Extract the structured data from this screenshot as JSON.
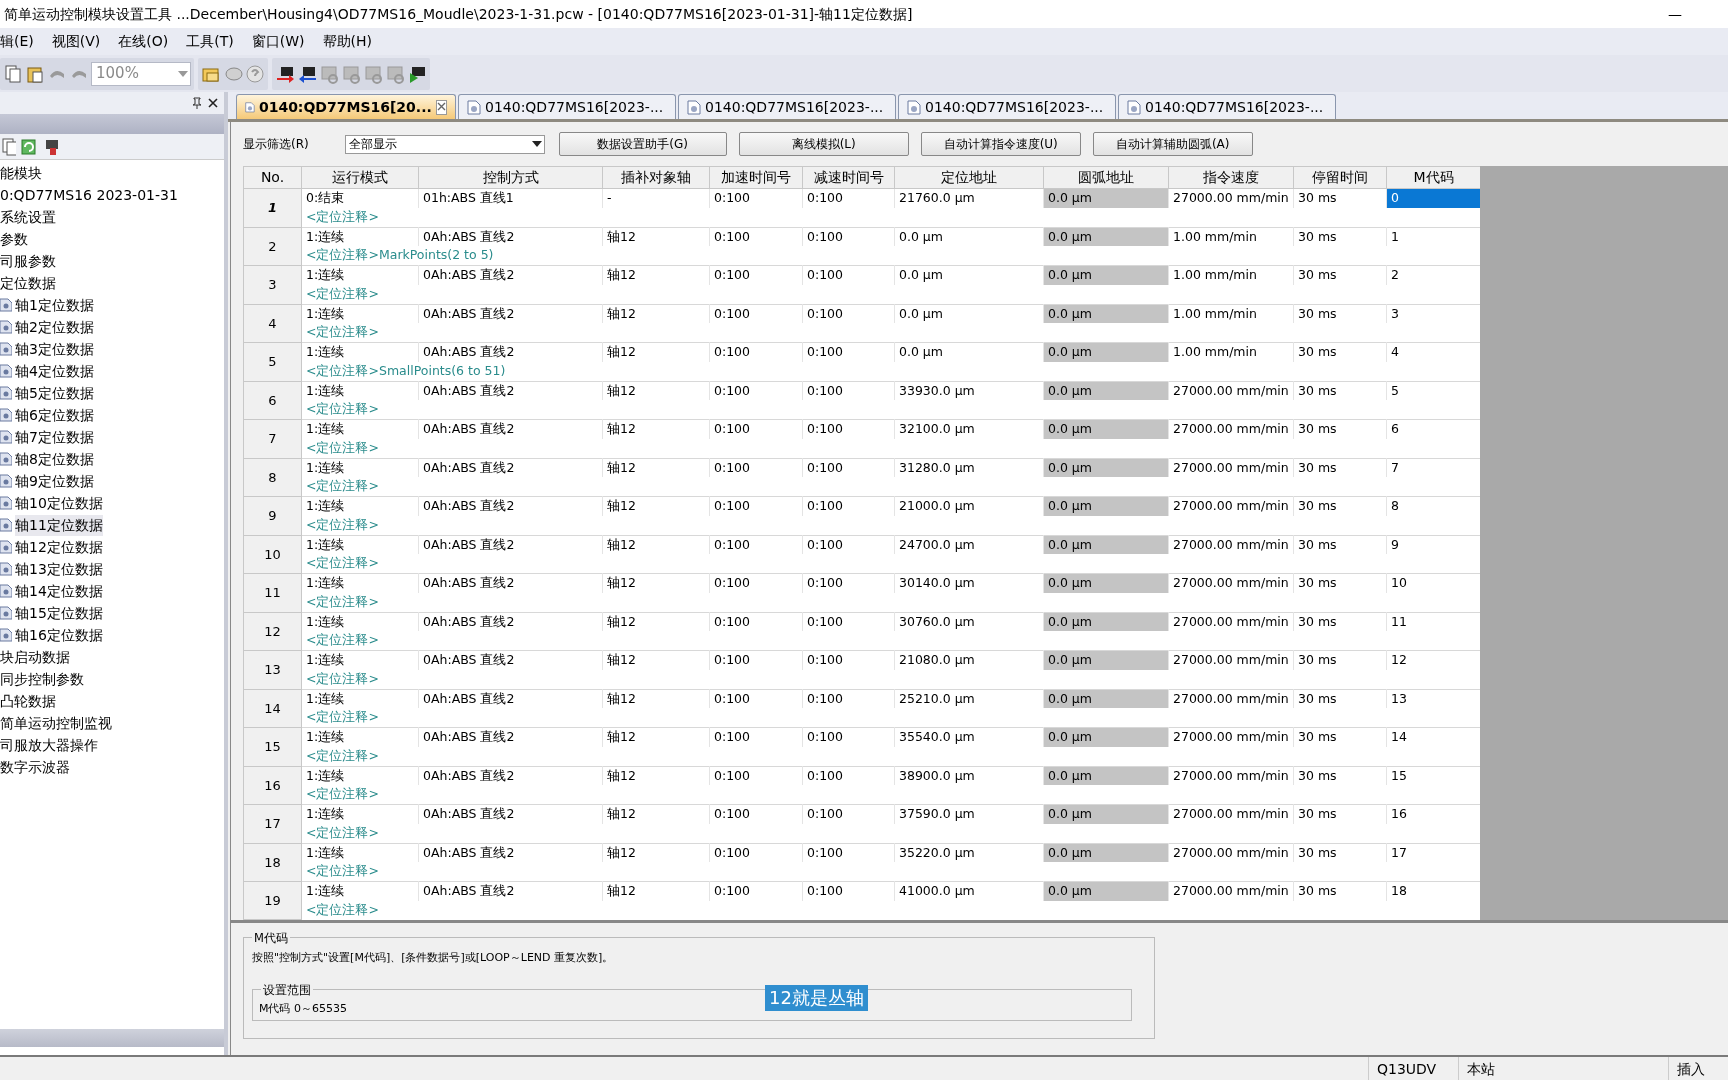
{
  "window": {
    "title": "简单运动控制模块设置工具 ...December\\Housing4\\OD77MS16_Moudle\\2023-1-31.pcw - [0140:QD77MS16[2023-01-31]-轴11定位数据]",
    "minimize": "—"
  },
  "menu": [
    "辑(E)",
    "视图(V)",
    "在线(O)",
    "工具(T)",
    "窗口(W)",
    "帮助(H)"
  ],
  "toolbar": {
    "zoom": "100%"
  },
  "sidebar": {
    "items": [
      {
        "label": "能模块",
        "children": [
          {
            "label": "0:QD77MS16 2023-01-31",
            "children": [
              {
                "label": "系统设置",
                "selected": false
              },
              {
                "label": "参数",
                "selected": false
              },
              {
                "label": "司服参数",
                "selected": false
              },
              {
                "label": "定位数据",
                "selected": false,
                "children": [
                  {
                    "label": "轴1定位数据",
                    "selected": false
                  },
                  {
                    "label": "轴2定位数据",
                    "selected": false
                  },
                  {
                    "label": "轴3定位数据",
                    "selected": false
                  },
                  {
                    "label": "轴4定位数据",
                    "selected": false
                  },
                  {
                    "label": "轴5定位数据",
                    "selected": false
                  },
                  {
                    "label": "轴6定位数据",
                    "selected": false
                  },
                  {
                    "label": "轴7定位数据",
                    "selected": false
                  },
                  {
                    "label": "轴8定位数据",
                    "selected": false
                  },
                  {
                    "label": "轴9定位数据",
                    "selected": false
                  },
                  {
                    "label": "轴10定位数据",
                    "selected": false
                  },
                  {
                    "label": "轴11定位数据",
                    "selected": true
                  },
                  {
                    "label": "轴12定位数据",
                    "selected": false
                  },
                  {
                    "label": "轴13定位数据",
                    "selected": false
                  },
                  {
                    "label": "轴14定位数据",
                    "selected": false
                  },
                  {
                    "label": "轴15定位数据",
                    "selected": false
                  },
                  {
                    "label": "轴16定位数据",
                    "selected": false
                  }
                ]
              },
              {
                "label": "块启动数据",
                "selected": false
              },
              {
                "label": "同步控制参数",
                "selected": false
              },
              {
                "label": "凸轮数据",
                "selected": false
              },
              {
                "label": "简单运动控制监视",
                "selected": false
              },
              {
                "label": "司服放大器操作",
                "selected": false
              },
              {
                "label": "数字示波器",
                "selected": false
              }
            ]
          }
        ]
      }
    ]
  },
  "tabs": [
    {
      "label": "0140:QD77MS16[20...",
      "selected": true
    },
    {
      "label": "0140:QD77MS16[2023-...",
      "selected": false
    },
    {
      "label": "0140:QD77MS16[2023-...",
      "selected": false
    },
    {
      "label": "0140:QD77MS16[2023-...",
      "selected": false
    },
    {
      "label": "0140:QD77MS16[2023-...",
      "selected": false
    }
  ],
  "filter": {
    "label": "显示筛选(R)",
    "value": "全部显示"
  },
  "buttons": [
    "数据设置助手(G)",
    "离线模拟(L)",
    "自动计算指令速度(U)",
    "自动计算辅助圆弧(A)"
  ],
  "table": {
    "columns": [
      "No.",
      "运行模式",
      "控制方式",
      "插补对象轴",
      "加速时间号",
      "减速时间号",
      "定位地址",
      "圆弧地址",
      "指令速度",
      "停留时间",
      "M代码"
    ],
    "rows": [
      {
        "selected": true,
        "cells": [
          "1",
          "0:结束",
          "01h:ABS 直线1",
          "-",
          "0:100",
          "0:100",
          "21760.0 μm",
          "0.0 μm",
          "27000.00 mm/min",
          "30 ms",
          "0"
        ],
        "comment": "<定位注释>"
      },
      {
        "selected": false,
        "cells": [
          "2",
          "1:连续",
          "0Ah:ABS 直线2",
          "轴12",
          "0:100",
          "0:100",
          "0.0 μm",
          "0.0 μm",
          "1.00 mm/min",
          "30 ms",
          "1"
        ],
        "comment": "<定位注释>MarkPoints(2 to 5)"
      },
      {
        "selected": false,
        "cells": [
          "3",
          "1:连续",
          "0Ah:ABS 直线2",
          "轴12",
          "0:100",
          "0:100",
          "0.0 μm",
          "0.0 μm",
          "1.00 mm/min",
          "30 ms",
          "2"
        ],
        "comment": "<定位注释>"
      },
      {
        "selected": false,
        "cells": [
          "4",
          "1:连续",
          "0Ah:ABS 直线2",
          "轴12",
          "0:100",
          "0:100",
          "0.0 μm",
          "0.0 μm",
          "1.00 mm/min",
          "30 ms",
          "3"
        ],
        "comment": "<定位注释>"
      },
      {
        "selected": false,
        "cells": [
          "5",
          "1:连续",
          "0Ah:ABS 直线2",
          "轴12",
          "0:100",
          "0:100",
          "0.0 μm",
          "0.0 μm",
          "1.00 mm/min",
          "30 ms",
          "4"
        ],
        "comment": "<定位注释>SmallPoints(6 to 51)"
      },
      {
        "selected": false,
        "cells": [
          "6",
          "1:连续",
          "0Ah:ABS 直线2",
          "轴12",
          "0:100",
          "0:100",
          "33930.0 μm",
          "0.0 μm",
          "27000.00 mm/min",
          "30 ms",
          "5"
        ],
        "comment": "<定位注释>"
      },
      {
        "selected": false,
        "cells": [
          "7",
          "1:连续",
          "0Ah:ABS 直线2",
          "轴12",
          "0:100",
          "0:100",
          "32100.0 μm",
          "0.0 μm",
          "27000.00 mm/min",
          "30 ms",
          "6"
        ],
        "comment": "<定位注释>"
      },
      {
        "selected": false,
        "cells": [
          "8",
          "1:连续",
          "0Ah:ABS 直线2",
          "轴12",
          "0:100",
          "0:100",
          "31280.0 μm",
          "0.0 μm",
          "27000.00 mm/min",
          "30 ms",
          "7"
        ],
        "comment": "<定位注释>"
      },
      {
        "selected": false,
        "cells": [
          "9",
          "1:连续",
          "0Ah:ABS 直线2",
          "轴12",
          "0:100",
          "0:100",
          "21000.0 μm",
          "0.0 μm",
          "27000.00 mm/min",
          "30 ms",
          "8"
        ],
        "comment": "<定位注释>"
      },
      {
        "selected": false,
        "cells": [
          "10",
          "1:连续",
          "0Ah:ABS 直线2",
          "轴12",
          "0:100",
          "0:100",
          "24700.0 μm",
          "0.0 μm",
          "27000.00 mm/min",
          "30 ms",
          "9"
        ],
        "comment": "<定位注释>"
      },
      {
        "selected": false,
        "cells": [
          "11",
          "1:连续",
          "0Ah:ABS 直线2",
          "轴12",
          "0:100",
          "0:100",
          "30140.0 μm",
          "0.0 μm",
          "27000.00 mm/min",
          "30 ms",
          "10"
        ],
        "comment": "<定位注释>"
      },
      {
        "selected": false,
        "cells": [
          "12",
          "1:连续",
          "0Ah:ABS 直线2",
          "轴12",
          "0:100",
          "0:100",
          "30760.0 μm",
          "0.0 μm",
          "27000.00 mm/min",
          "30 ms",
          "11"
        ],
        "comment": "<定位注释>"
      },
      {
        "selected": false,
        "cells": [
          "13",
          "1:连续",
          "0Ah:ABS 直线2",
          "轴12",
          "0:100",
          "0:100",
          "21080.0 μm",
          "0.0 μm",
          "27000.00 mm/min",
          "30 ms",
          "12"
        ],
        "comment": "<定位注释>"
      },
      {
        "selected": false,
        "cells": [
          "14",
          "1:连续",
          "0Ah:ABS 直线2",
          "轴12",
          "0:100",
          "0:100",
          "25210.0 μm",
          "0.0 μm",
          "27000.00 mm/min",
          "30 ms",
          "13"
        ],
        "comment": "<定位注释>"
      },
      {
        "selected": false,
        "cells": [
          "15",
          "1:连续",
          "0Ah:ABS 直线2",
          "轴12",
          "0:100",
          "0:100",
          "35540.0 μm",
          "0.0 μm",
          "27000.00 mm/min",
          "30 ms",
          "14"
        ],
        "comment": "<定位注释>"
      },
      {
        "selected": false,
        "cells": [
          "16",
          "1:连续",
          "0Ah:ABS 直线2",
          "轴12",
          "0:100",
          "0:100",
          "38900.0 μm",
          "0.0 μm",
          "27000.00 mm/min",
          "30 ms",
          "15"
        ],
        "comment": "<定位注释>"
      },
      {
        "selected": false,
        "cells": [
          "17",
          "1:连续",
          "0Ah:ABS 直线2",
          "轴12",
          "0:100",
          "0:100",
          "37590.0 μm",
          "0.0 μm",
          "27000.00 mm/min",
          "30 ms",
          "16"
        ],
        "comment": "<定位注释>"
      },
      {
        "selected": false,
        "cells": [
          "18",
          "1:连续",
          "0Ah:ABS 直线2",
          "轴12",
          "0:100",
          "0:100",
          "35220.0 μm",
          "0.0 μm",
          "27000.00 mm/min",
          "30 ms",
          "17"
        ],
        "comment": "<定位注释>"
      },
      {
        "selected": false,
        "cells": [
          "19",
          "1:连续",
          "0Ah:ABS 直线2",
          "轴12",
          "0:100",
          "0:100",
          "41000.0 μm",
          "0.0 μm",
          "27000.00 mm/min",
          "30 ms",
          "18"
        ],
        "comment": "<定位注释>"
      }
    ]
  },
  "help": {
    "title": "M代码",
    "text": "按照\"控制方式\"设置[M代码]、[条件数据号]或[LOOP～LEND 重复次数]。",
    "range_title": "设置范围",
    "range": "M代码 0～65535"
  },
  "caption": "12就是丛轴",
  "status_bar": [
    "Q13UDV",
    "本站",
    "插入"
  ]
}
